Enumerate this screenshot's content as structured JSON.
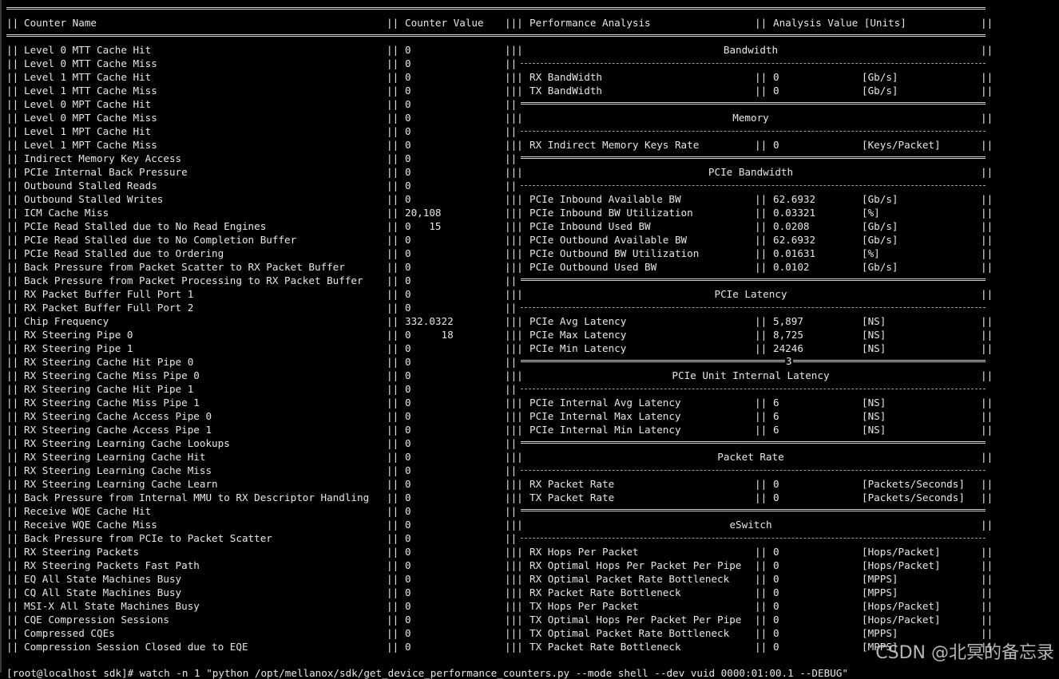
{
  "header": {
    "counter_name": "Counter Name",
    "counter_value": "Counter Value",
    "performance_analysis": "Performance Analysis",
    "analysis_value": "Analysis Value [Units]"
  },
  "counters": [
    {
      "name": "Level 0 MTT Cache Hit",
      "value": "0"
    },
    {
      "name": "Level 0 MTT Cache Miss",
      "value": "0"
    },
    {
      "name": "Level 1 MTT Cache Hit",
      "value": "0"
    },
    {
      "name": "Level 1 MTT Cache Miss",
      "value": "0"
    },
    {
      "name": "Level 0 MPT Cache Hit",
      "value": "0"
    },
    {
      "name": "Level 0 MPT Cache Miss",
      "value": "0"
    },
    {
      "name": "Level 1 MPT Cache Hit",
      "value": "0"
    },
    {
      "name": "Level 1 MPT Cache Miss",
      "value": "0"
    },
    {
      "name": "Indirect Memory Key Access",
      "value": "0"
    },
    {
      "name": "PCIe Internal Back Pressure",
      "value": "0"
    },
    {
      "name": "Outbound Stalled Reads",
      "value": "0"
    },
    {
      "name": "Outbound Stalled Writes",
      "value": "0"
    },
    {
      "name": "ICM Cache Miss",
      "value": "20,108"
    },
    {
      "name": "PCIe Read Stalled due to No Read Engines",
      "value": "0   15"
    },
    {
      "name": "PCIe Read Stalled due to No Completion Buffer",
      "value": "0"
    },
    {
      "name": "PCIe Read Stalled due to Ordering",
      "value": "0"
    },
    {
      "name": "Back Pressure from Packet Scatter to RX Packet Buffer",
      "value": "0"
    },
    {
      "name": "Back Pressure from Packet Processing to RX Packet Buffer",
      "value": "0"
    },
    {
      "name": "RX Packet Buffer Full Port 1",
      "value": "0"
    },
    {
      "name": "RX Packet Buffer Full Port 2",
      "value": "0"
    },
    {
      "name": "Chip Frequency",
      "value": "332.0322"
    },
    {
      "name": "RX Steering Pipe 0",
      "value": "0     18"
    },
    {
      "name": "RX Steering Pipe 1",
      "value": "0"
    },
    {
      "name": "RX Steering Cache Hit Pipe 0",
      "value": "0"
    },
    {
      "name": "RX Steering Cache Miss Pipe 0",
      "value": "0"
    },
    {
      "name": "RX Steering Cache Hit Pipe 1",
      "value": "0"
    },
    {
      "name": "RX Steering Cache Miss Pipe 1",
      "value": "0"
    },
    {
      "name": "RX Steering Cache Access Pipe 0",
      "value": "0"
    },
    {
      "name": "RX Steering Cache Access Pipe 1",
      "value": "0"
    },
    {
      "name": "RX Steering Learning Cache Lookups",
      "value": "0"
    },
    {
      "name": "RX Steering Learning Cache Hit",
      "value": "0"
    },
    {
      "name": "RX Steering Learning Cache Miss",
      "value": "0"
    },
    {
      "name": "RX Steering Learning Cache Learn",
      "value": "0"
    },
    {
      "name": "Back Pressure from Internal MMU to RX Descriptor Handling",
      "value": "0"
    },
    {
      "name": "Receive WQE Cache Hit",
      "value": "0"
    },
    {
      "name": "Receive WQE Cache Miss",
      "value": "0"
    },
    {
      "name": "Back Pressure from PCIe to Packet Scatter",
      "value": "0"
    },
    {
      "name": "RX Steering Packets",
      "value": "0"
    },
    {
      "name": "RX Steering Packets Fast Path",
      "value": "0"
    },
    {
      "name": "EQ All State Machines Busy",
      "value": "0"
    },
    {
      "name": "CQ All State Machines Busy",
      "value": "0"
    },
    {
      "name": "MSI-X All State Machines Busy",
      "value": "0"
    },
    {
      "name": "CQE Compression Sessions",
      "value": "0"
    },
    {
      "name": "Compressed CQEs",
      "value": "0"
    },
    {
      "name": "Compression Session Closed due to EQE",
      "value": "0"
    }
  ],
  "right": [
    {
      "kind": "title",
      "text": "Bandwidth"
    },
    {
      "kind": "dash"
    },
    {
      "kind": "row",
      "name": "RX BandWidth",
      "value": "0",
      "unit": "[Gb/s]"
    },
    {
      "kind": "row",
      "name": "TX BandWidth",
      "value": "0",
      "unit": "[Gb/s]"
    },
    {
      "kind": "dbl",
      "mark": ""
    },
    {
      "kind": "title",
      "text": "Memory"
    },
    {
      "kind": "dash"
    },
    {
      "kind": "row",
      "name": "RX Indirect Memory Keys Rate",
      "value": "0",
      "unit": "[Keys/Packet]"
    },
    {
      "kind": "dbl",
      "mark": ""
    },
    {
      "kind": "title",
      "text": "PCIe Bandwidth"
    },
    {
      "kind": "dash"
    },
    {
      "kind": "row",
      "name": "PCIe Inbound Available BW",
      "value": "62.6932",
      "unit": "[Gb/s]"
    },
    {
      "kind": "row",
      "name": "PCIe Inbound BW Utilization",
      "value": "0.03321",
      "unit": "[%]"
    },
    {
      "kind": "row",
      "name": "PCIe Inbound Used BW",
      "value": "0.0208",
      "unit": "[Gb/s]"
    },
    {
      "kind": "row",
      "name": "PCIe Outbound Available BW",
      "value": "62.6932",
      "unit": "[Gb/s]"
    },
    {
      "kind": "row",
      "name": "PCIe Outbound BW Utilization",
      "value": "0.01631",
      "unit": "[%]"
    },
    {
      "kind": "row",
      "name": "PCIe Outbound Used BW",
      "value": "0.0102",
      "unit": "[Gb/s]"
    },
    {
      "kind": "dbl",
      "mark": ""
    },
    {
      "kind": "title",
      "text": "PCIe Latency"
    },
    {
      "kind": "dash"
    },
    {
      "kind": "row",
      "name": "PCIe Avg Latency",
      "value": "5,897",
      "unit": "[NS]"
    },
    {
      "kind": "row",
      "name": "PCIe Max Latency",
      "value": "8,725",
      "unit": "[NS]"
    },
    {
      "kind": "row",
      "name": "PCIe Min Latency",
      "value": "24246",
      "unit": "[NS]"
    },
    {
      "kind": "dbl",
      "mark": "3"
    },
    {
      "kind": "title",
      "text": "PCIe Unit Internal Latency"
    },
    {
      "kind": "dash"
    },
    {
      "kind": "row",
      "name": "PCIe Internal Avg Latency",
      "value": "6",
      "unit": "[NS]"
    },
    {
      "kind": "row",
      "name": "PCIe Internal Max Latency",
      "value": "6",
      "unit": "[NS]"
    },
    {
      "kind": "row",
      "name": "PCIe Internal Min Latency",
      "value": "6",
      "unit": "[NS]"
    },
    {
      "kind": "dbl",
      "mark": ""
    },
    {
      "kind": "title",
      "text": "Packet Rate"
    },
    {
      "kind": "dash"
    },
    {
      "kind": "row",
      "name": "RX Packet Rate",
      "value": "0",
      "unit": "[Packets/Seconds]"
    },
    {
      "kind": "row",
      "name": "TX Packet Rate",
      "value": "0",
      "unit": "[Packets/Seconds]"
    },
    {
      "kind": "dbl",
      "mark": ""
    },
    {
      "kind": "title",
      "text": "eSwitch"
    },
    {
      "kind": "dash"
    },
    {
      "kind": "row",
      "name": "RX Hops Per Packet",
      "value": "0",
      "unit": "[Hops/Packet]"
    },
    {
      "kind": "row",
      "name": "RX Optimal Hops Per Packet Per Pipe",
      "value": "0",
      "unit": "[Hops/Packet]"
    },
    {
      "kind": "row",
      "name": "RX Optimal Packet Rate Bottleneck",
      "value": "0",
      "unit": "[MPPS]"
    },
    {
      "kind": "row",
      "name": "RX Packet Rate Bottleneck",
      "value": "0",
      "unit": "[MPPS]"
    },
    {
      "kind": "row",
      "name": "TX Hops Per Packet",
      "value": "0",
      "unit": "[Hops/Packet]"
    },
    {
      "kind": "row",
      "name": "TX Optimal Hops Per Packet Per Pipe",
      "value": "0",
      "unit": "[Hops/Packet]"
    },
    {
      "kind": "row",
      "name": "TX Optimal Packet Rate Bottleneck",
      "value": "0",
      "unit": "[MPPS]"
    },
    {
      "kind": "row",
      "name": "TX Packet Rate Bottleneck",
      "value": "0",
      "unit": "[MPPS]"
    }
  ],
  "command_line": "[root@localhost sdk]# watch -n 1 \"python /opt/mellanox/sdk/get_device_performance_counters.py --mode shell --dev vuid 0000:01:00.1 --DEBUG\"",
  "watermark": "CSDN @北冥的备忘录"
}
